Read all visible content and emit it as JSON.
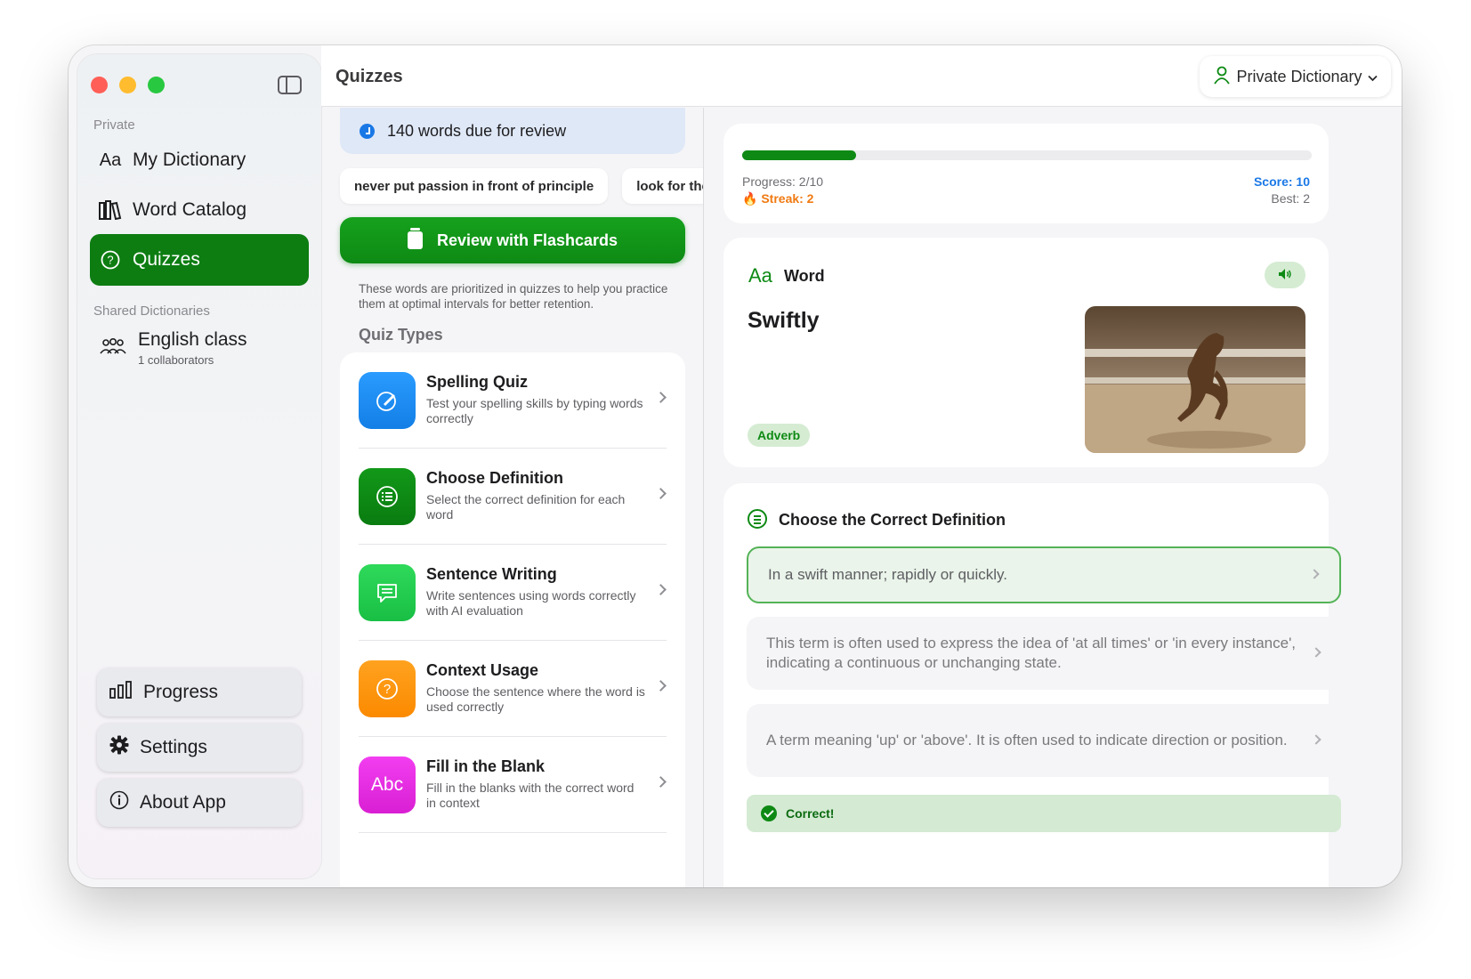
{
  "sidebar": {
    "section_private": "Private",
    "items": [
      {
        "label": "My Dictionary",
        "icon": "Aa"
      },
      {
        "label": "Word Catalog",
        "icon": "books-icon"
      },
      {
        "label": "Quizzes",
        "icon": "question-circle-icon"
      }
    ],
    "section_shared": "Shared Dictionaries",
    "shared": {
      "name": "English class",
      "sub": "1 collaborators"
    },
    "bottom": [
      {
        "label": "Progress",
        "icon": "chart-bars-icon"
      },
      {
        "label": "Settings",
        "icon": "gear-icon"
      },
      {
        "label": "About App",
        "icon": "info-icon"
      }
    ]
  },
  "header": {
    "title": "Quizzes",
    "dictionary": "Private Dictionary"
  },
  "center": {
    "due_banner": "140 words due for review",
    "chips": [
      "never put passion in front of principle",
      "look for the"
    ],
    "flashcards_button": "Review with Flashcards",
    "hint": "These words are prioritized in quizzes to help you practice them at optimal intervals for better retention.",
    "quiz_types_label": "Quiz Types",
    "quiz_types": [
      {
        "title": "Spelling Quiz",
        "desc": "Test your spelling skills by typing words correctly",
        "color": "#1a8cf0",
        "icon": "pencil-circle-icon"
      },
      {
        "title": "Choose Definition",
        "desc": "Select the correct definition for each word",
        "color": "#0e8a14",
        "icon": "list-circle-icon"
      },
      {
        "title": "Sentence Writing",
        "desc": "Write sentences using words correctly with AI evaluation",
        "color": "#1fca4c",
        "icon": "message-icon"
      },
      {
        "title": "Context Usage",
        "desc": "Choose the sentence where the word is used correctly",
        "color": "#ff9300",
        "icon": "question-circle-icon"
      },
      {
        "title": "Fill in the Blank",
        "desc": "Fill in the blanks with the correct word in context",
        "color": "#e62ae0",
        "icon": "Abc"
      }
    ]
  },
  "quiz": {
    "progress_label": "Progress: 2/10",
    "progress_fraction": 0.2,
    "streak_label": "Streak: 2",
    "score_label": "Score: 10",
    "best_label": "Best: 2",
    "word_section_label": "Word",
    "word": "Swiftly",
    "part_of_speech": "Adverb",
    "definition_title": "Choose the Correct Definition",
    "options": [
      "In a swift manner; rapidly or quickly.",
      "This term is often used to express the idea of 'at all times' or 'in every instance', indicating a continuous or unchanging state.",
      "A term meaning 'up' or 'above'. It is often used to indicate direction or position."
    ],
    "feedback": "Correct!"
  },
  "colors": {
    "accent_green": "#0e8a14",
    "score_blue": "#1a78e6",
    "streak_orange": "#f07a12"
  }
}
